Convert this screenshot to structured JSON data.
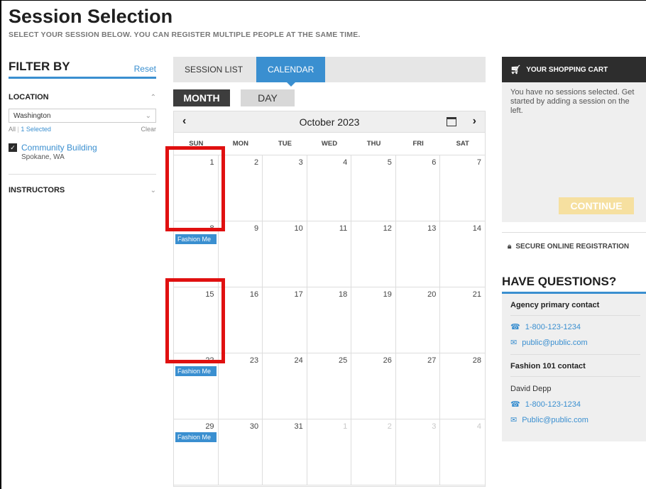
{
  "header": {
    "title": "Session Selection",
    "subtitle": "SELECT YOUR SESSION BELOW. YOU CAN REGISTER MULTIPLE PEOPLE AT THE SAME TIME."
  },
  "filter": {
    "title": "FILTER BY",
    "reset": "Reset",
    "location_label": "LOCATION",
    "location_value": "Washington",
    "all_label": "All",
    "selected_label": "1 Selected",
    "clear_label": "Clear",
    "location_name": "Community Building",
    "location_city": "Spokane, WA",
    "instructors_label": "INSTRUCTORS"
  },
  "tabs": {
    "session_list": "SESSION LIST",
    "calendar": "CALENDAR"
  },
  "view": {
    "month": "MONTH",
    "day": "DAY"
  },
  "calendar": {
    "month_label": "October 2023",
    "prev_icon": "chevron-left-icon",
    "next_icon": "chevron-right-icon",
    "weekdays": [
      "SUN",
      "MON",
      "TUE",
      "WED",
      "THU",
      "FRI",
      "SAT"
    ],
    "days": [
      {
        "num": "1"
      },
      {
        "num": "2"
      },
      {
        "num": "3"
      },
      {
        "num": "4"
      },
      {
        "num": "5"
      },
      {
        "num": "6"
      },
      {
        "num": "7"
      },
      {
        "num": "8",
        "event": "Fashion Me"
      },
      {
        "num": "9"
      },
      {
        "num": "10"
      },
      {
        "num": "11"
      },
      {
        "num": "12"
      },
      {
        "num": "13"
      },
      {
        "num": "14"
      },
      {
        "num": "15"
      },
      {
        "num": "16"
      },
      {
        "num": "17"
      },
      {
        "num": "18"
      },
      {
        "num": "19"
      },
      {
        "num": "20"
      },
      {
        "num": "21"
      },
      {
        "num": "22",
        "event": "Fashion Me"
      },
      {
        "num": "23"
      },
      {
        "num": "24"
      },
      {
        "num": "25"
      },
      {
        "num": "26"
      },
      {
        "num": "27"
      },
      {
        "num": "28"
      },
      {
        "num": "29",
        "event": "Fashion Me"
      },
      {
        "num": "30"
      },
      {
        "num": "31"
      },
      {
        "num": "1",
        "other": true
      },
      {
        "num": "2",
        "other": true
      },
      {
        "num": "3",
        "other": true
      },
      {
        "num": "4",
        "other": true
      }
    ]
  },
  "cart": {
    "title": "YOUR SHOPPING CART",
    "empty_text": "You have no sessions selected. Get started by adding a session on the left.",
    "continue": "CONTINUE"
  },
  "secure": "SECURE ONLINE REGISTRATION",
  "questions": {
    "title": "HAVE QUESTIONS?",
    "agency_label": "Agency primary contact",
    "agency_phone": "1-800-123-1234",
    "agency_email": "public@public.com",
    "course_label": "Fashion 101 contact",
    "contact_name": "David Depp",
    "contact_phone": "1-800-123-1234",
    "contact_email": "Public@public.com"
  },
  "colors": {
    "accent": "#3a8fd0",
    "highlight": "#e01010",
    "continue_disabled": "#f6e0a0"
  }
}
